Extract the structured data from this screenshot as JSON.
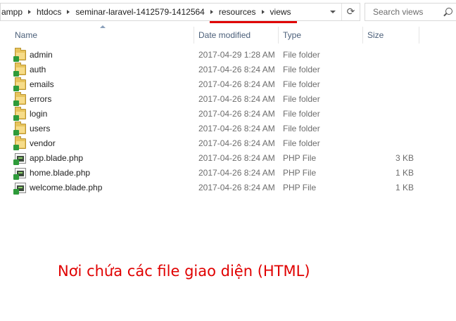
{
  "breadcrumb": [
    "ampp",
    "htdocs",
    "seminar-laravel-1412579-1412564",
    "resources",
    "views"
  ],
  "search": {
    "placeholder": "Search views"
  },
  "columns": {
    "name": "Name",
    "date": "Date modified",
    "type": "Type",
    "size": "Size"
  },
  "files": [
    {
      "name": "admin",
      "date": "2017-04-29 1:28 AM",
      "type": "File folder",
      "size": "",
      "icon": "folder-icon"
    },
    {
      "name": "auth",
      "date": "2017-04-26 8:24 AM",
      "type": "File folder",
      "size": "",
      "icon": "folder-icon"
    },
    {
      "name": "emails",
      "date": "2017-04-26 8:24 AM",
      "type": "File folder",
      "size": "",
      "icon": "folder-icon"
    },
    {
      "name": "errors",
      "date": "2017-04-26 8:24 AM",
      "type": "File folder",
      "size": "",
      "icon": "folder-icon"
    },
    {
      "name": "login",
      "date": "2017-04-26 8:24 AM",
      "type": "File folder",
      "size": "",
      "icon": "folder-icon"
    },
    {
      "name": "users",
      "date": "2017-04-26 8:24 AM",
      "type": "File folder",
      "size": "",
      "icon": "folder-icon"
    },
    {
      "name": "vendor",
      "date": "2017-04-26 8:24 AM",
      "type": "File folder",
      "size": "",
      "icon": "folder-icon"
    },
    {
      "name": "app.blade.php",
      "date": "2017-04-26 8:24 AM",
      "type": "PHP File",
      "size": "3 KB",
      "icon": "php-file-icon"
    },
    {
      "name": "home.blade.php",
      "date": "2017-04-26 8:24 AM",
      "type": "PHP File",
      "size": "1 KB",
      "icon": "php-file-icon"
    },
    {
      "name": "welcome.blade.php",
      "date": "2017-04-26 8:24 AM",
      "type": "PHP File",
      "size": "1 KB",
      "icon": "php-file-icon"
    }
  ],
  "annotation": "Nơi chứa các file giao diện (HTML)",
  "colors": {
    "annotation": "#e00000",
    "header_text": "#4c607a"
  }
}
